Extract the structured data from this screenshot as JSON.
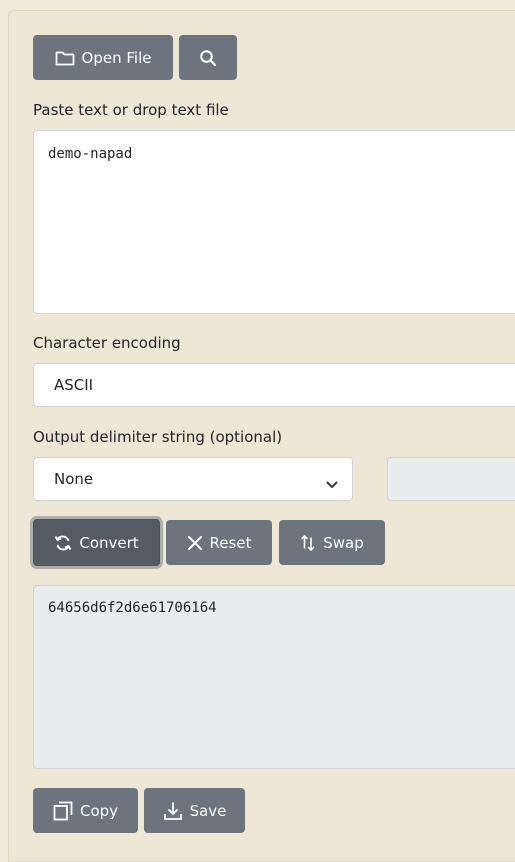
{
  "toolbar": {
    "open_file_label": "Open File",
    "open_file_icon": "folder-icon",
    "search_icon": "search-icon"
  },
  "input": {
    "label": "Paste text or drop text file",
    "value": "demo-napad"
  },
  "encoding": {
    "label": "Character encoding",
    "value": "ASCII"
  },
  "delimiter": {
    "label": "Output delimiter string (optional)",
    "selected": "None",
    "custom_value": ""
  },
  "actions": {
    "convert_label": "Convert",
    "reset_label": "Reset",
    "swap_label": "Swap"
  },
  "output": {
    "value": "64656d6f2d6e61706164"
  },
  "output_actions": {
    "copy_label": "Copy",
    "save_label": "Save"
  },
  "colors": {
    "background": "#f0e8d8",
    "button": "#6c757d",
    "button_active": "#545b62",
    "output_bg": "#e9ecef"
  }
}
